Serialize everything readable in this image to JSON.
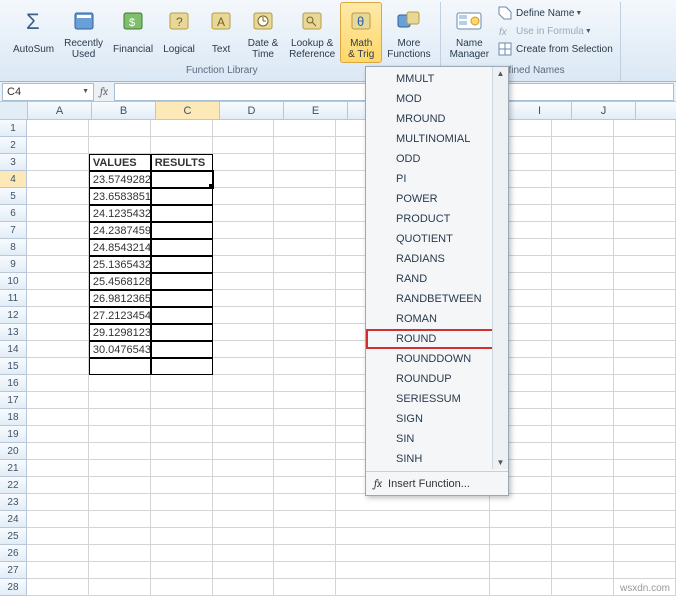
{
  "ribbon": {
    "library_label": "Function Library",
    "names_label": "Defined Names",
    "buttons": {
      "autosum": "AutoSum",
      "recently": "Recently\nUsed",
      "financial": "Financial",
      "logical": "Logical",
      "text": "Text",
      "datetime": "Date &\nTime",
      "lookup": "Lookup &\nReference",
      "mathtrig": "Math\n& Trig",
      "more": "More\nFunctions",
      "namemgr": "Name\nManager",
      "define": "Define Name",
      "usein": "Use in Formula",
      "createfrom": "Create from Selection"
    }
  },
  "namebox": "C4",
  "columns": [
    "A",
    "B",
    "C",
    "D",
    "E",
    "",
    "",
    "",
    "I",
    "J"
  ],
  "data_header": {
    "values": "VALUES",
    "results": "RESULTS"
  },
  "data_rows": [
    "23.5749282",
    "23.6583851",
    "24.1235432",
    "24.2387459",
    "24.8543214",
    "25.1365432",
    "25.4568128",
    "26.9812365",
    "27.2123454",
    "29.1298123",
    "30.0476543"
  ],
  "menu": {
    "items": [
      "MMULT",
      "MOD",
      "MROUND",
      "MULTINOMIAL",
      "ODD",
      "PI",
      "POWER",
      "PRODUCT",
      "QUOTIENT",
      "RADIANS",
      "RAND",
      "RANDBETWEEN",
      "ROMAN",
      "ROUND",
      "ROUNDDOWN",
      "ROUNDUP",
      "SERIESSUM",
      "SIGN",
      "SIN",
      "SINH"
    ],
    "highlight": "ROUND",
    "insert_fn": "Insert Function..."
  },
  "watermark": "wsxdn.com"
}
